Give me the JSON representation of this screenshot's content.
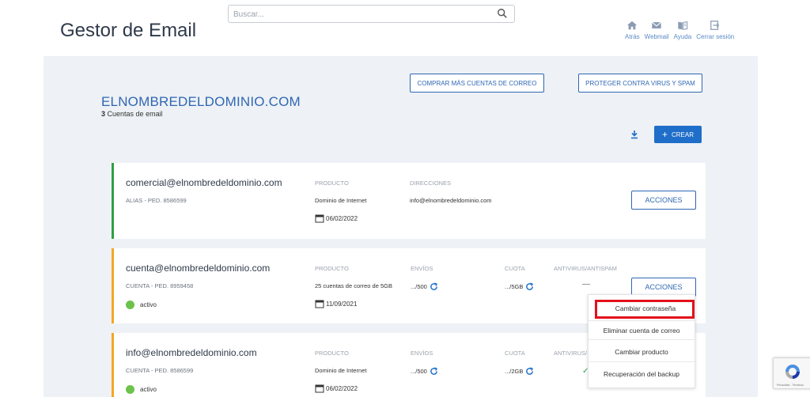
{
  "header": {
    "title": "Gestor de Email",
    "search_placeholder": "Buscar...",
    "nav": [
      {
        "label": "Atrás",
        "icon": "home-icon"
      },
      {
        "label": "Webmail",
        "icon": "mail-icon"
      },
      {
        "label": "Ayuda",
        "icon": "book-icon"
      },
      {
        "label": "Cerrar sesión",
        "icon": "logout-icon"
      }
    ]
  },
  "domain": {
    "name": "ELNOMBREDELDOMINIO.COM",
    "count": "3",
    "count_label": "Cuentas de email"
  },
  "toolbar": {
    "buy_more": "COMPRAR MÁS CUENTAS DE CORREO",
    "protect": "PROTEGER CONTRA VIRUS Y SPAM",
    "create": "CREAR"
  },
  "columns": {
    "product": "PRODUCTO",
    "addresses": "DIRECCIONES",
    "sends": "ENVÍOS",
    "quota": "CUOTA",
    "antivirus": "ANTIVIRUS/ANTISPAM",
    "antivirus_truncated": "ANTIVIRUS/"
  },
  "accounts": [
    {
      "email": "comercial@elnombredeldominio.com",
      "sub": "ALIAS - PED. 8586599",
      "product": "Dominio de Internet",
      "date": "06/02/2022",
      "address": "info@elnombredeldominio.com",
      "actions": "ACCIONES",
      "accent": "#2fa043"
    },
    {
      "email": "cuenta@elnombredeldominio.com",
      "sub": "CUENTA - PED. 8959458",
      "status": "activo",
      "product": "25 cuentas de correo de 5GB",
      "date": "11/09/2021",
      "sends": ".../500",
      "quota": ".../5GB",
      "antivirus": "—",
      "actions": "ACCIONES",
      "accent": "#f5a623"
    },
    {
      "email": "info@elnombredeldominio.com",
      "sub": "CUENTA - PED. 8586599",
      "status": "activo",
      "product": "Dominio de Internet",
      "date": "06/02/2022",
      "sends": ".../500",
      "quota": ".../2GB",
      "antivirus": "✓",
      "accent": "#f5a623"
    }
  ],
  "dropdown": {
    "items": [
      "Cambiar contraseña",
      "Eliminar cuenta de correo",
      "Cambiar producto",
      "Recuperación del backup"
    ],
    "highlight_color": "#e3101a"
  },
  "colors": {
    "brand_blue": "#2f67b4",
    "create_button": "#1f6ec9",
    "status_active": "#6cc24a",
    "panel_bg": "#eef1f5"
  },
  "recaptcha": {
    "text": "Privacidad - Términos"
  }
}
